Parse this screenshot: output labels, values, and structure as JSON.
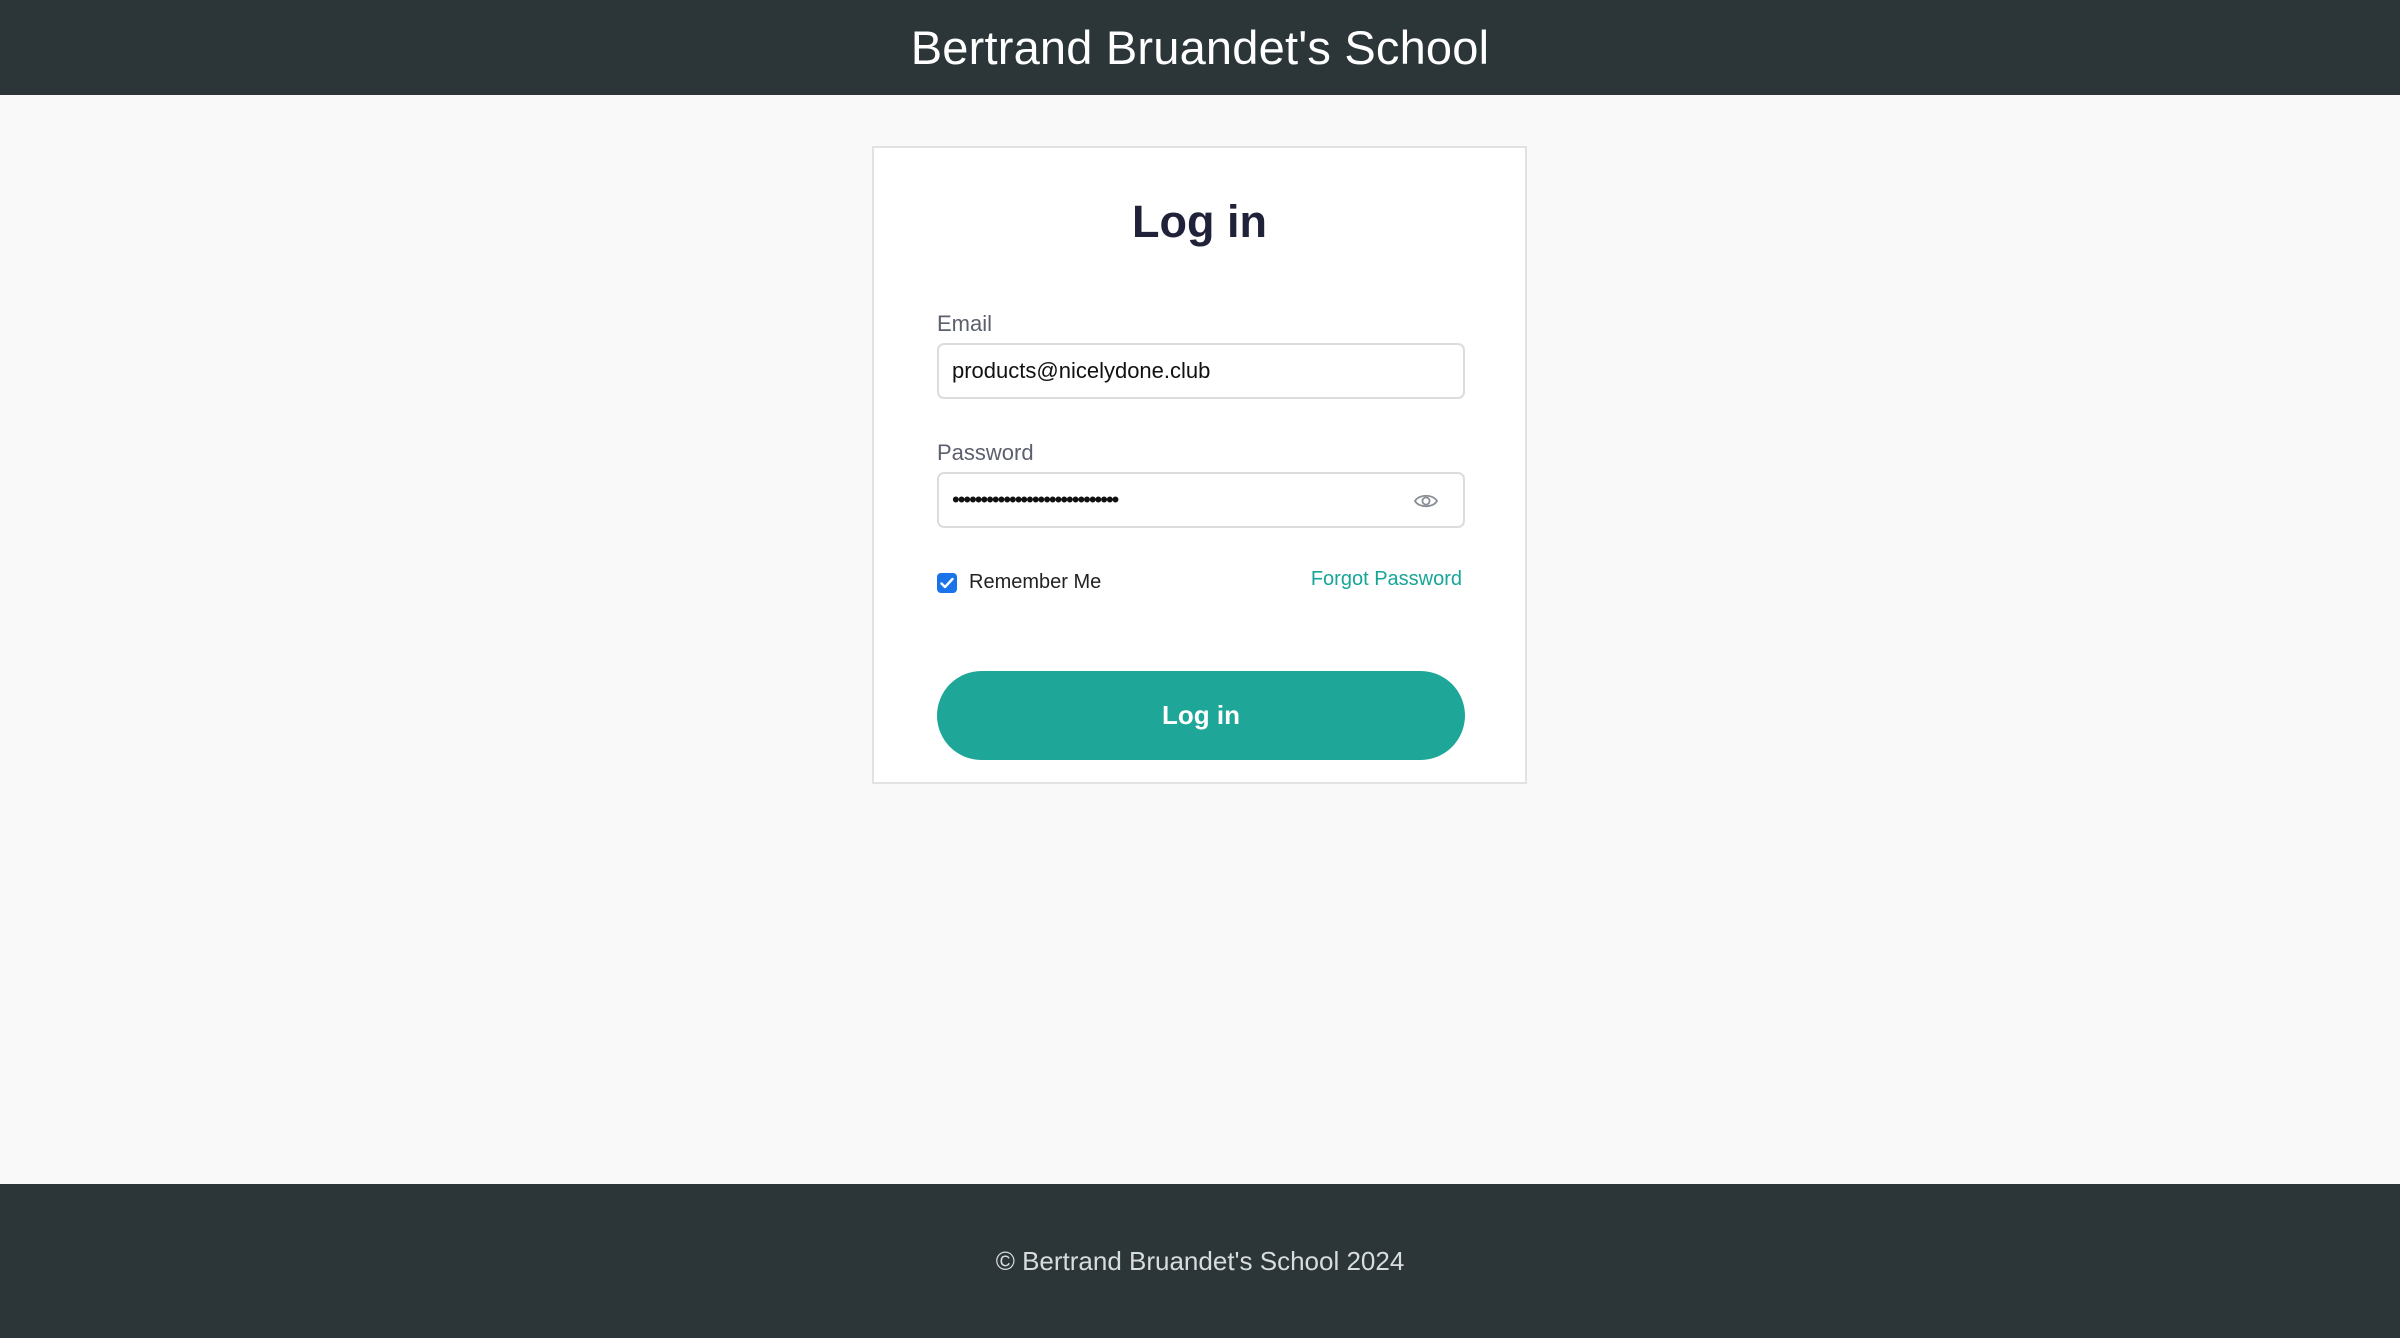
{
  "header": {
    "title": "Bertrand Bruandet's School"
  },
  "login_form": {
    "title": "Log in",
    "email": {
      "label": "Email",
      "value": "products@nicelydone.club"
    },
    "password": {
      "label": "Password",
      "value": "•••••••••••••••••••••••••••••",
      "toggle_icon": "eye-icon"
    },
    "remember_me": {
      "label": "Remember Me",
      "checked": true
    },
    "forgot_password_label": "Forgot Password",
    "submit_label": "Log in"
  },
  "footer": {
    "text": "© Bertrand Bruandet's School 2024"
  },
  "colors": {
    "header_bg": "#2c3638",
    "accent": "#1ea698",
    "link": "#17a598",
    "checkbox": "#1a73e8"
  }
}
